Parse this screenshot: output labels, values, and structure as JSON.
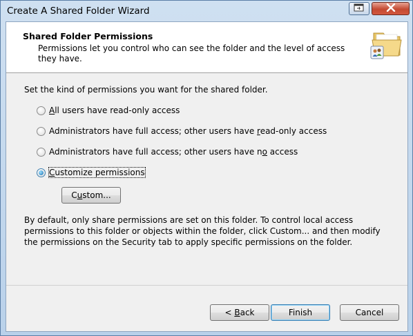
{
  "window": {
    "title": "Create A Shared Folder Wizard"
  },
  "header": {
    "title": "Shared Folder Permissions",
    "description": "Permissions let you control who can see the folder and the level of access they have.",
    "icon": "shared-folder-icon"
  },
  "body": {
    "intro": "Set the kind of permissions you want for the shared folder.",
    "options": [
      {
        "pre": "",
        "key": "A",
        "post": "ll users have read-only access",
        "checked": false
      },
      {
        "pre": "Administrators have full access; other users have ",
        "key": "r",
        "post": "ead-only access",
        "checked": false
      },
      {
        "pre": "Administrators have full access; other users have n",
        "key": "o",
        "post": " access",
        "checked": false
      },
      {
        "pre": "",
        "key": "C",
        "post": "ustomize permissions",
        "checked": true
      }
    ],
    "custom_button": {
      "pre": "C",
      "key": "u",
      "post": "stom..."
    },
    "info": "By default, only share permissions are set on this folder. To control local access permissions to this folder or objects within the folder, click Custom... and then modify the permissions on the Security tab to apply specific permissions on the folder."
  },
  "footer": {
    "back": {
      "pre": "< ",
      "key": "B",
      "post": "ack"
    },
    "finish": "Finish",
    "cancel": "Cancel"
  },
  "colors": {
    "title_gradient_top": "#cfe0f1",
    "close_button": "#c44a32",
    "dialog_bg": "#f0f0f0",
    "header_bg": "#ffffff"
  }
}
